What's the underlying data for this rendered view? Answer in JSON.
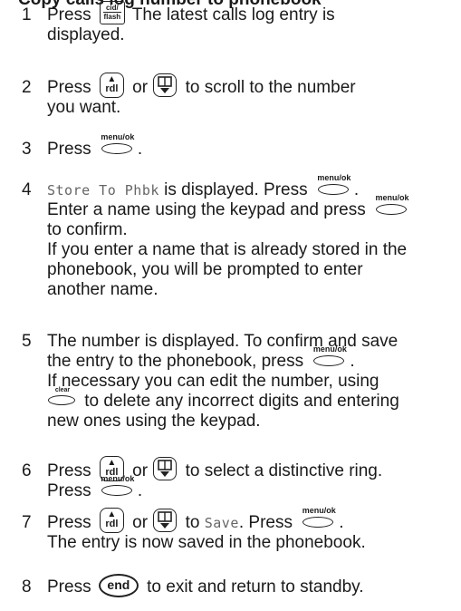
{
  "header": {
    "cut_text": "Copy calls log number to phonebook"
  },
  "keys": {
    "cid_top": "cid/",
    "cid_bottom": "flash",
    "rdl": "rdl",
    "menu_ok": "menu/ok",
    "clear": "clear",
    "end": "end"
  },
  "lcd": {
    "store": "Store To Phbk",
    "save": "Save"
  },
  "steps": [
    {
      "num": "1",
      "l1_a": "Press",
      "l1_b": " The latest calls log entry is",
      "l2": "displayed."
    },
    {
      "num": "2",
      "l1_a": "Press",
      "l1_b": "or",
      "l1_c": " to scroll to the number",
      "l2": "you want."
    },
    {
      "num": "3",
      "l1_a": "Press",
      "l1_b": "."
    },
    {
      "num": "4",
      "l1_b": " is displayed. Press",
      "l1_c": ".",
      "l2_a": "Enter a name using the keypad and press",
      "l3": "to confirm.",
      "l4": "If you enter a name that is already stored in the",
      "l5": "phonebook, you will be prompted to enter",
      "l6": "another name."
    },
    {
      "num": "5",
      "l1": "The number is displayed. To confirm and save",
      "l2_a": "the entry to the phonebook, press",
      "l2_b": ".",
      "l3": "If necessary you can edit the number, using",
      "l4_b": " to delete any incorrect digits and entering",
      "l5": "new ones using the keypad."
    },
    {
      "num": "6",
      "l1_a": "Press",
      "l1_b": "or",
      "l1_c": " to select a distinctive ring.",
      "l2_a": "Press",
      "l2_b": "."
    },
    {
      "num": "7",
      "l1_a": "Press",
      "l1_b": "or",
      "l1_c": " to ",
      "l1_d": ". Press",
      "l1_e": ".",
      "l2": "The entry is now saved in the phonebook."
    },
    {
      "num": "8",
      "l1_a": "Press",
      "l1_b": " to exit and return to standby."
    }
  ]
}
